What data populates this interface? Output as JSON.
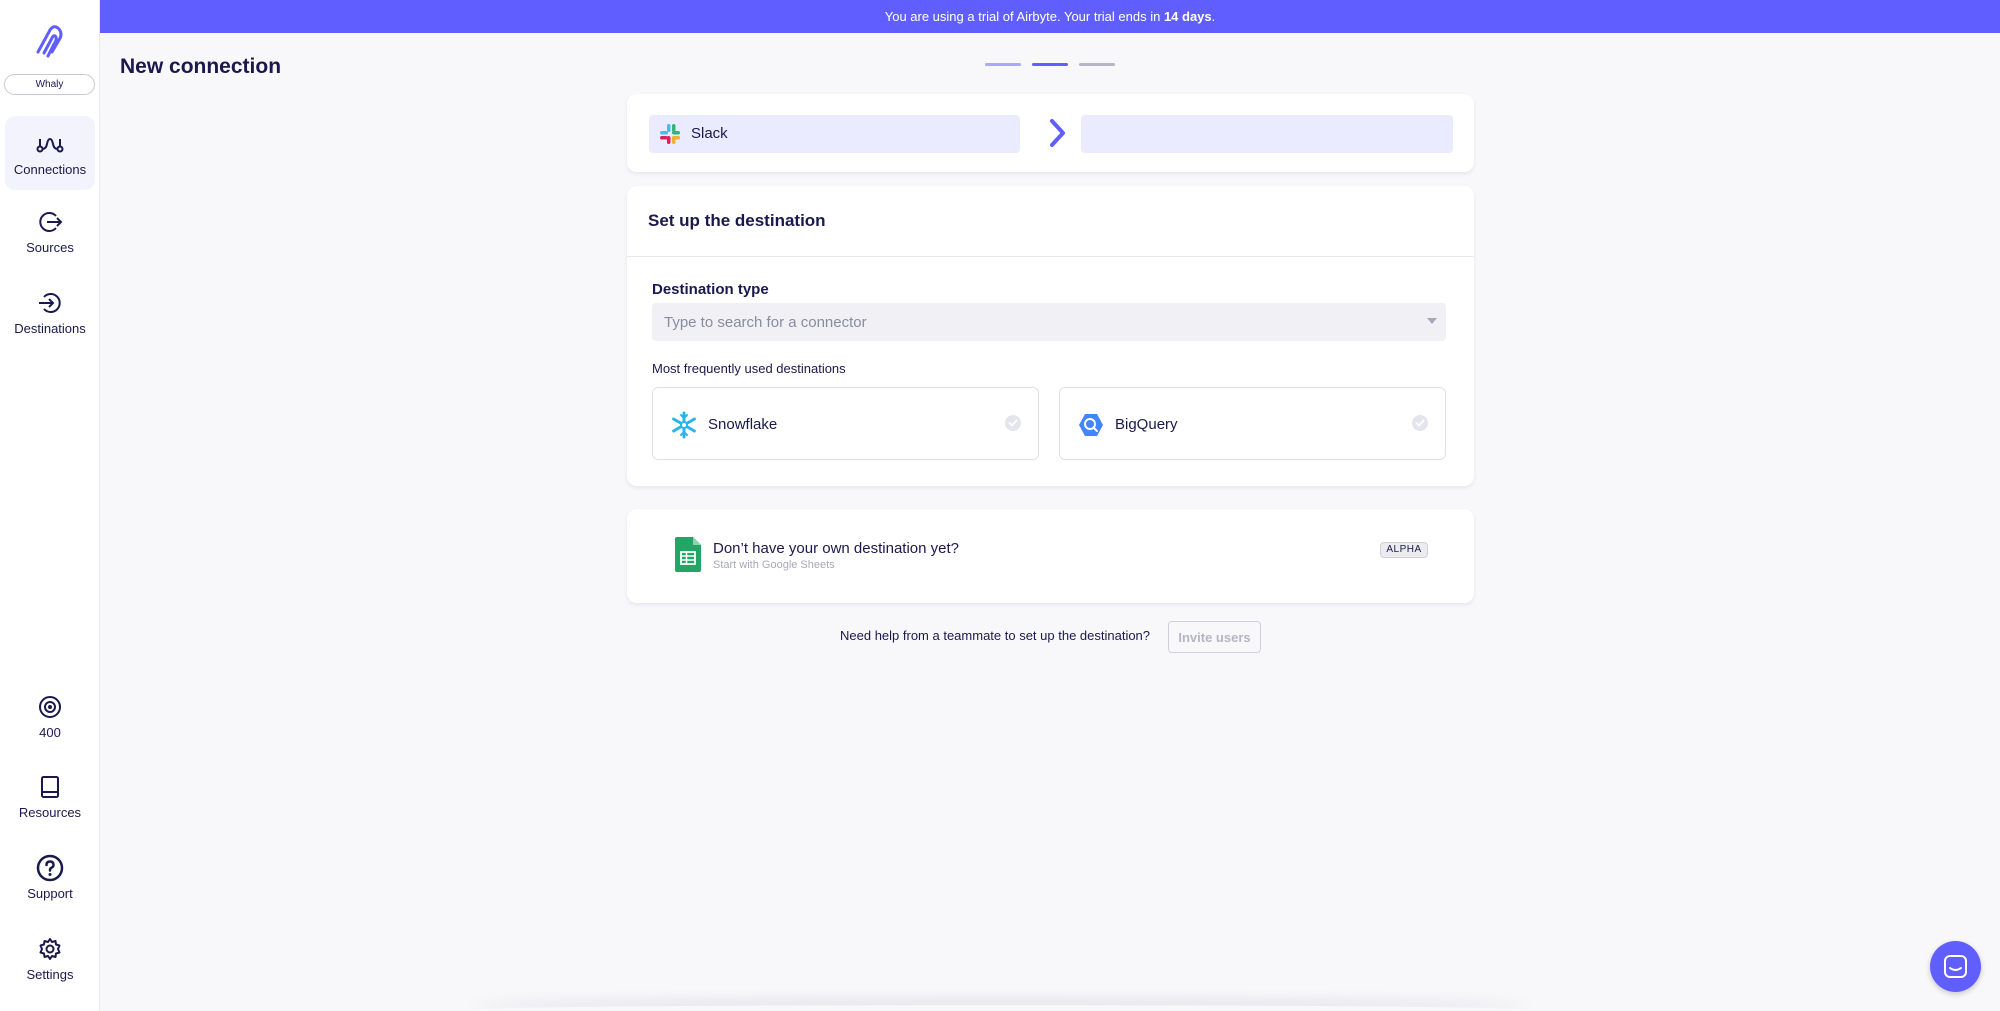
{
  "sidebar": {
    "workspace": "Whaly",
    "nav": [
      {
        "label": "Connections",
        "icon": "connections-icon",
        "active": true
      },
      {
        "label": "Sources",
        "icon": "sources-icon"
      },
      {
        "label": "Destinations",
        "icon": "destinations-icon"
      }
    ],
    "bottom": [
      {
        "label": "400",
        "icon": "credits-icon"
      },
      {
        "label": "Resources",
        "icon": "book-icon"
      },
      {
        "label": "Support",
        "icon": "question-circle-icon"
      },
      {
        "label": "Settings",
        "icon": "gear-icon"
      }
    ]
  },
  "banner": {
    "text_before": "You are using a trial of Airbyte. Your trial ends in ",
    "days": "14 days",
    "text_after": "."
  },
  "page": {
    "title": "New connection"
  },
  "steps": {
    "colors": [
      "#a9a7ff",
      "#615eff",
      "#b5b5c5"
    ]
  },
  "connection": {
    "source_name": "Slack",
    "destination_name": ""
  },
  "destination_setup": {
    "title": "Set up the destination",
    "field_label": "Destination type",
    "search_placeholder": "Type to search for a connector",
    "frequent_label": "Most frequently used destinations",
    "options": [
      {
        "name": "Snowflake",
        "icon": "snowflake-icon"
      },
      {
        "name": "BigQuery",
        "icon": "bigquery-icon"
      }
    ]
  },
  "sheets_promo": {
    "title": "Don’t have your own destination yet?",
    "subtitle": "Start with Google Sheets",
    "badge": "ALPHA"
  },
  "help": {
    "text": "Need help from a teammate to set up the destination?",
    "button": "Invite users"
  },
  "colors": {
    "accent": "#615eff",
    "text": "#1a194d",
    "background": "#f8f8fa"
  }
}
